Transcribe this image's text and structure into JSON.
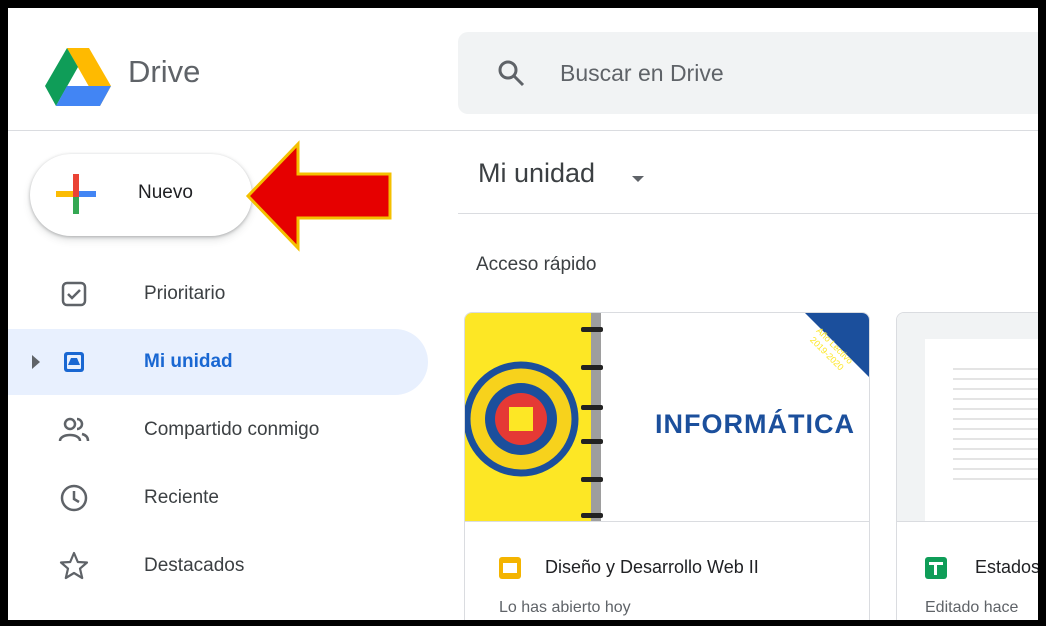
{
  "app": {
    "name": "Drive"
  },
  "search": {
    "placeholder": "Buscar en Drive"
  },
  "new_button": {
    "label": "Nuevo"
  },
  "sidebar": {
    "items": [
      {
        "label": "Prioritario",
        "icon": "priority-check-icon"
      },
      {
        "label": "Mi unidad",
        "icon": "my-drive-icon",
        "active": true
      },
      {
        "label": "Compartido conmigo",
        "icon": "shared-people-icon"
      },
      {
        "label": "Reciente",
        "icon": "clock-icon"
      },
      {
        "label": "Destacados",
        "icon": "star-icon"
      }
    ]
  },
  "main": {
    "title": "Mi unidad",
    "quick_access_label": "Acceso rápido",
    "cards": [
      {
        "name": "Diseño y Desarrollo Web II",
        "subtitle": "Lo has abierto hoy",
        "thumb_text": "INFORMÁTICA",
        "ribbon_line1": "Año Lectivo",
        "ribbon_line2": "2019-2020",
        "type": "slides"
      },
      {
        "name": "Estados",
        "subtitle": "Editado hace",
        "type": "sheets"
      }
    ]
  },
  "colors": {
    "accent": "#1967d2",
    "active_bg": "#e8f0fe",
    "annotation_arrow": "#e60000",
    "slides_yellow": "#f4b400",
    "sheets_green": "#0f9d58",
    "thumb_yellow": "#fde725",
    "thumb_blue": "#1b4f9c"
  }
}
